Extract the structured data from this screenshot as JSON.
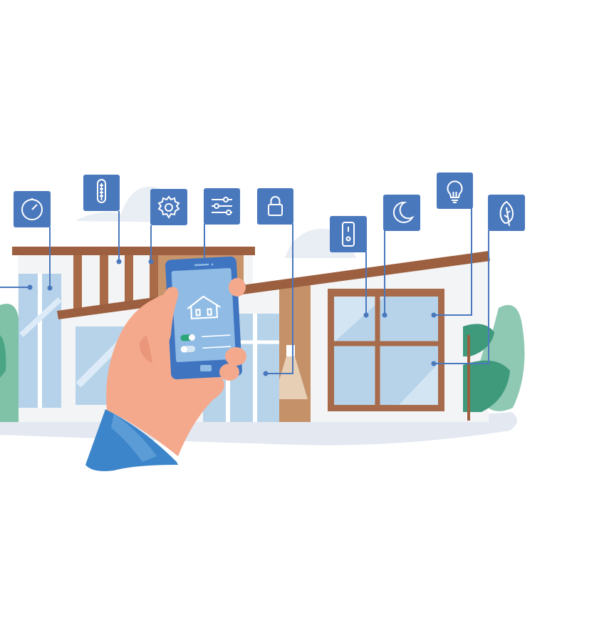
{
  "illustration": {
    "subject": "smart-home",
    "colors": {
      "icon_box": "#4a78bd",
      "connector_line": "#4a78bd",
      "roof_brown": "#9c5f3f",
      "wood": "#c49169",
      "wall": "#f4f5f7",
      "glass": "#b7d3ea",
      "ground": "#e4e8f0",
      "cloud": "#e6ebf3",
      "bush_light": "#8fc9b3",
      "bush_dark": "#3f9a7c",
      "skin": "#f4a98d",
      "sleeve": "#3c85ca",
      "phone_body": "#3f74c1",
      "phone_screen": "#8fbbe5",
      "toggle_on": "#2da57a"
    },
    "icons": [
      "timer-icon",
      "thermometer-icon",
      "settings-gear-icon",
      "sliders-icon",
      "lock-icon",
      "switch-icon",
      "moon-icon",
      "lightbulb-icon",
      "leaf-icon"
    ],
    "phone_screen": {
      "icon": "house-icon",
      "toggles": [
        {
          "name": "toggle-1",
          "state": "on"
        },
        {
          "name": "toggle-2",
          "state": "off"
        }
      ]
    }
  }
}
